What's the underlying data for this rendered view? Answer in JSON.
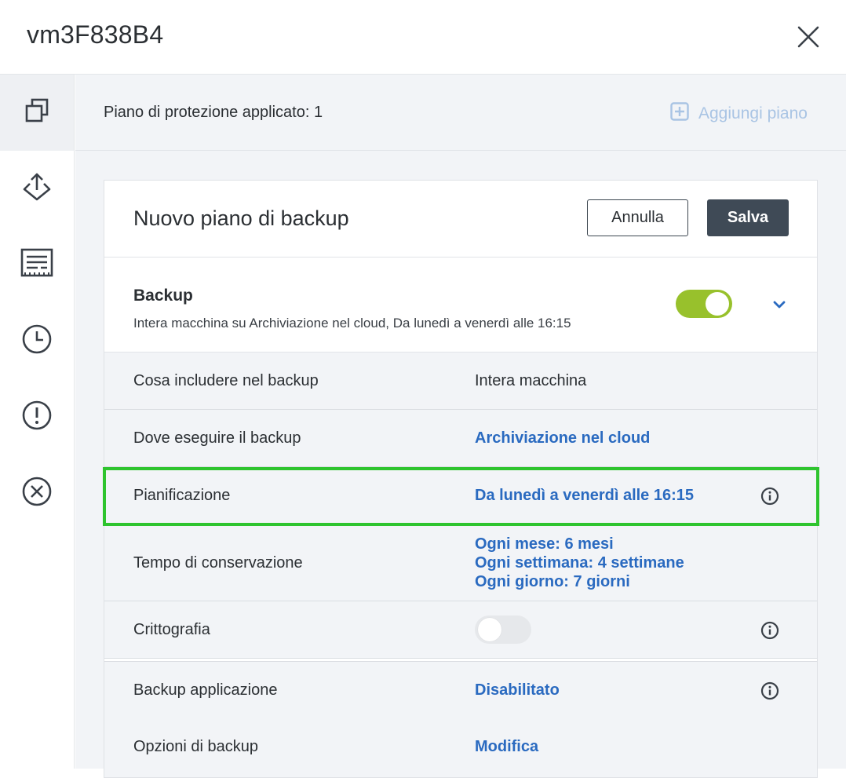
{
  "window": {
    "title": "vm3F838B4"
  },
  "sidebar": {
    "items": [
      {
        "name": "plans",
        "icon": "copy-squares-icon",
        "active": true
      },
      {
        "name": "recovery",
        "icon": "upload-arrow-icon"
      },
      {
        "name": "reports",
        "icon": "document-list-icon"
      },
      {
        "name": "history",
        "icon": "clock-icon"
      },
      {
        "name": "alerts",
        "icon": "exclamation-circle-icon"
      },
      {
        "name": "remove",
        "icon": "x-circle-icon"
      }
    ]
  },
  "plan_bar": {
    "applied_text": "Piano di protezione applicato: 1",
    "add_plan_label": "Aggiungi piano"
  },
  "card": {
    "title": "Nuovo piano di backup",
    "cancel_label": "Annulla",
    "save_label": "Salva",
    "backup": {
      "name": "Backup",
      "description": "Intera macchina su Archiviazione nel cloud, Da lunedì a venerdì alle 16:15",
      "enabled": true
    },
    "rows": {
      "what": {
        "label": "Cosa includere nel backup",
        "value": "Intera macchina"
      },
      "where": {
        "label": "Dove eseguire il backup",
        "value": "Archiviazione nel cloud"
      },
      "schedule": {
        "label": "Pianificazione",
        "value": "Da lunedì a venerdì alle 16:15"
      },
      "retention": {
        "label": "Tempo di conservazione",
        "values": [
          "Ogni mese: 6 mesi",
          "Ogni settimana: 4 settimane",
          "Ogni giorno: 7 giorni"
        ]
      },
      "encryption": {
        "label": "Crittografia",
        "enabled": false
      },
      "app_backup": {
        "label": "Backup applicazione",
        "value": "Disabilitato"
      },
      "options": {
        "label": "Opzioni di backup",
        "value": "Modifica"
      }
    }
  },
  "colors": {
    "accent_link": "#2a6ac0",
    "toggle_on": "#98c12c",
    "save_button": "#3f4a56",
    "highlight": "#2ec42e"
  }
}
